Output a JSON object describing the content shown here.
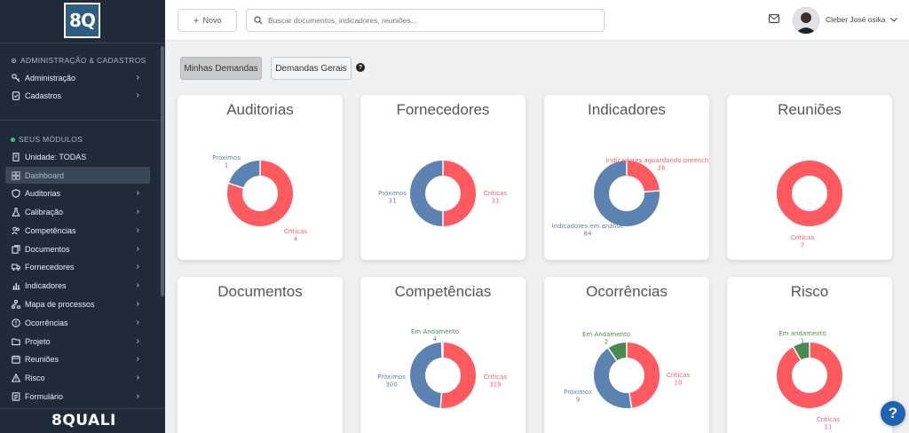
{
  "colors": {
    "critical": "#ff5a5f",
    "upcoming": "#5b82b0",
    "in_progress": "#4a8a50"
  },
  "sidebar": {
    "logo_text": "8Q",
    "section_admin": "ADMINISTRAÇÃO & CADASTROS",
    "admin_items": [
      {
        "label": "Administração",
        "icon": "key-icon"
      },
      {
        "label": "Cadastros",
        "icon": "file-check-icon"
      }
    ],
    "section_modules": "SEUS MÓDULOS",
    "module_items": [
      {
        "label": "Unidade: TODAS",
        "icon": "building-icon"
      },
      {
        "label": "Dashboard",
        "icon": "dashboard-icon"
      },
      {
        "label": "Auditorias",
        "icon": "shield-icon"
      },
      {
        "label": "Calibração",
        "icon": "flask-icon"
      },
      {
        "label": "Competências",
        "icon": "users-icon"
      },
      {
        "label": "Documentos",
        "icon": "documents-icon"
      },
      {
        "label": "Fornecedores",
        "icon": "truck-icon"
      },
      {
        "label": "Indicadores",
        "icon": "bar-chart-icon"
      },
      {
        "label": "Mapa de processos",
        "icon": "sitemap-icon"
      },
      {
        "label": "Ocorrências",
        "icon": "alert-icon"
      },
      {
        "label": "Projeto",
        "icon": "folder-icon"
      },
      {
        "label": "Reuniões",
        "icon": "calendar-icon"
      },
      {
        "label": "Risco",
        "icon": "warning-icon"
      },
      {
        "label": "Formulário",
        "icon": "form-icon"
      }
    ],
    "brand": "8QUALI"
  },
  "topbar": {
    "new_label": "Novo",
    "search_placeholder": "Buscar documentos, indicadores, reuniões...",
    "user_name": "Cleber José osika"
  },
  "tabs": {
    "mine": "Minhas Demandas",
    "general": "Demandas Gerais"
  },
  "cards": [
    {
      "title": "Auditorias"
    },
    {
      "title": "Fornecedores"
    },
    {
      "title": "Indicadores"
    },
    {
      "title": "Reuniões"
    },
    {
      "title": "Documentos"
    },
    {
      "title": "Competências"
    },
    {
      "title": "Ocorrências"
    },
    {
      "title": "Risco"
    }
  ],
  "chart_data": [
    {
      "type": "pie",
      "title": "Auditorias",
      "series": [
        {
          "label": "Críticas",
          "value": 4,
          "color": "#ff5a5f"
        },
        {
          "label": "Próximos",
          "value": 1,
          "color": "#5b82b0"
        }
      ]
    },
    {
      "type": "pie",
      "title": "Fornecedores",
      "series": [
        {
          "label": "Críticas",
          "value": 31,
          "color": "#ff5a5f"
        },
        {
          "label": "Próximos",
          "value": 31,
          "color": "#5b82b0"
        }
      ]
    },
    {
      "type": "pie",
      "title": "Indicadores",
      "series": [
        {
          "label": "Indicadores aguardando preenchim",
          "value": 26,
          "color": "#ff5a5f"
        },
        {
          "label": "Indicadores em análise",
          "value": 84,
          "color": "#5b82b0"
        }
      ]
    },
    {
      "type": "pie",
      "title": "Reuniões",
      "series": [
        {
          "label": "Críticas",
          "value": 7,
          "color": "#ff5a5f"
        }
      ]
    },
    {
      "type": "pie",
      "title": "Documentos",
      "series": []
    },
    {
      "type": "pie",
      "title": "Competências",
      "series": [
        {
          "label": "Críticas",
          "value": 319,
          "color": "#ff5a5f"
        },
        {
          "label": "Próximos",
          "value": 300,
          "color": "#5b82b0"
        },
        {
          "label": "Em Andamento",
          "value": 4,
          "color": "#4a8a50"
        }
      ]
    },
    {
      "type": "pie",
      "title": "Ocorrências",
      "series": [
        {
          "label": "Críticas",
          "value": 10,
          "color": "#ff5a5f"
        },
        {
          "label": "Próximos",
          "value": 9,
          "color": "#5b82b0"
        },
        {
          "label": "Em Andamento",
          "value": 2,
          "color": "#4a8a50"
        }
      ]
    },
    {
      "type": "pie",
      "title": "Risco",
      "series": [
        {
          "label": "Críticas",
          "value": 11,
          "color": "#ff5a5f"
        },
        {
          "label": "Em andamento",
          "value": 1,
          "color": "#4a8a50"
        }
      ]
    }
  ]
}
